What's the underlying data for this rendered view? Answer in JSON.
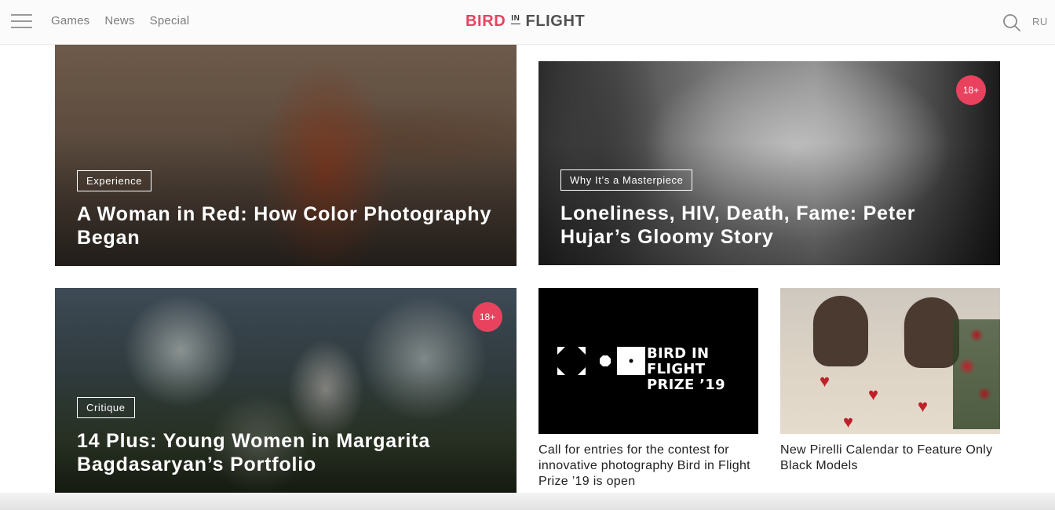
{
  "header": {
    "nav": [
      "Games",
      "News",
      "Special"
    ],
    "logo": {
      "bird": "BIRD",
      "in": "IN",
      "flight": "FLIGHT"
    },
    "lang": "RU"
  },
  "cards": [
    {
      "tag": "Experience",
      "title": "A Woman in Red: How Color Photography Began"
    },
    {
      "tag": "Why It’s a Masterpiece",
      "title": "Loneliness, HIV, Death, Fame: Peter Hujar’s Gloomy Story",
      "badge": "18+"
    },
    {
      "tag": "Critique",
      "title": "14 Plus: Young Women in Margarita Bagdasaryan’s Portfolio",
      "badge": "18+"
    }
  ],
  "small_cards": [
    {
      "logo_text_line1": "BIRD IN FLIGHT",
      "logo_text_line2": "PRIZE ’19",
      "title": "Call for entries for the contest for innovative photography Bird in Flight Prize ’19 is open"
    },
    {
      "title": "New Pirelli Calendar to Feature Only Black Models"
    }
  ],
  "colors": {
    "accent": "#e8425f",
    "text": "#222222",
    "nav": "#7d7d7d"
  },
  "icons": [
    "menu-icon",
    "search-icon"
  ]
}
